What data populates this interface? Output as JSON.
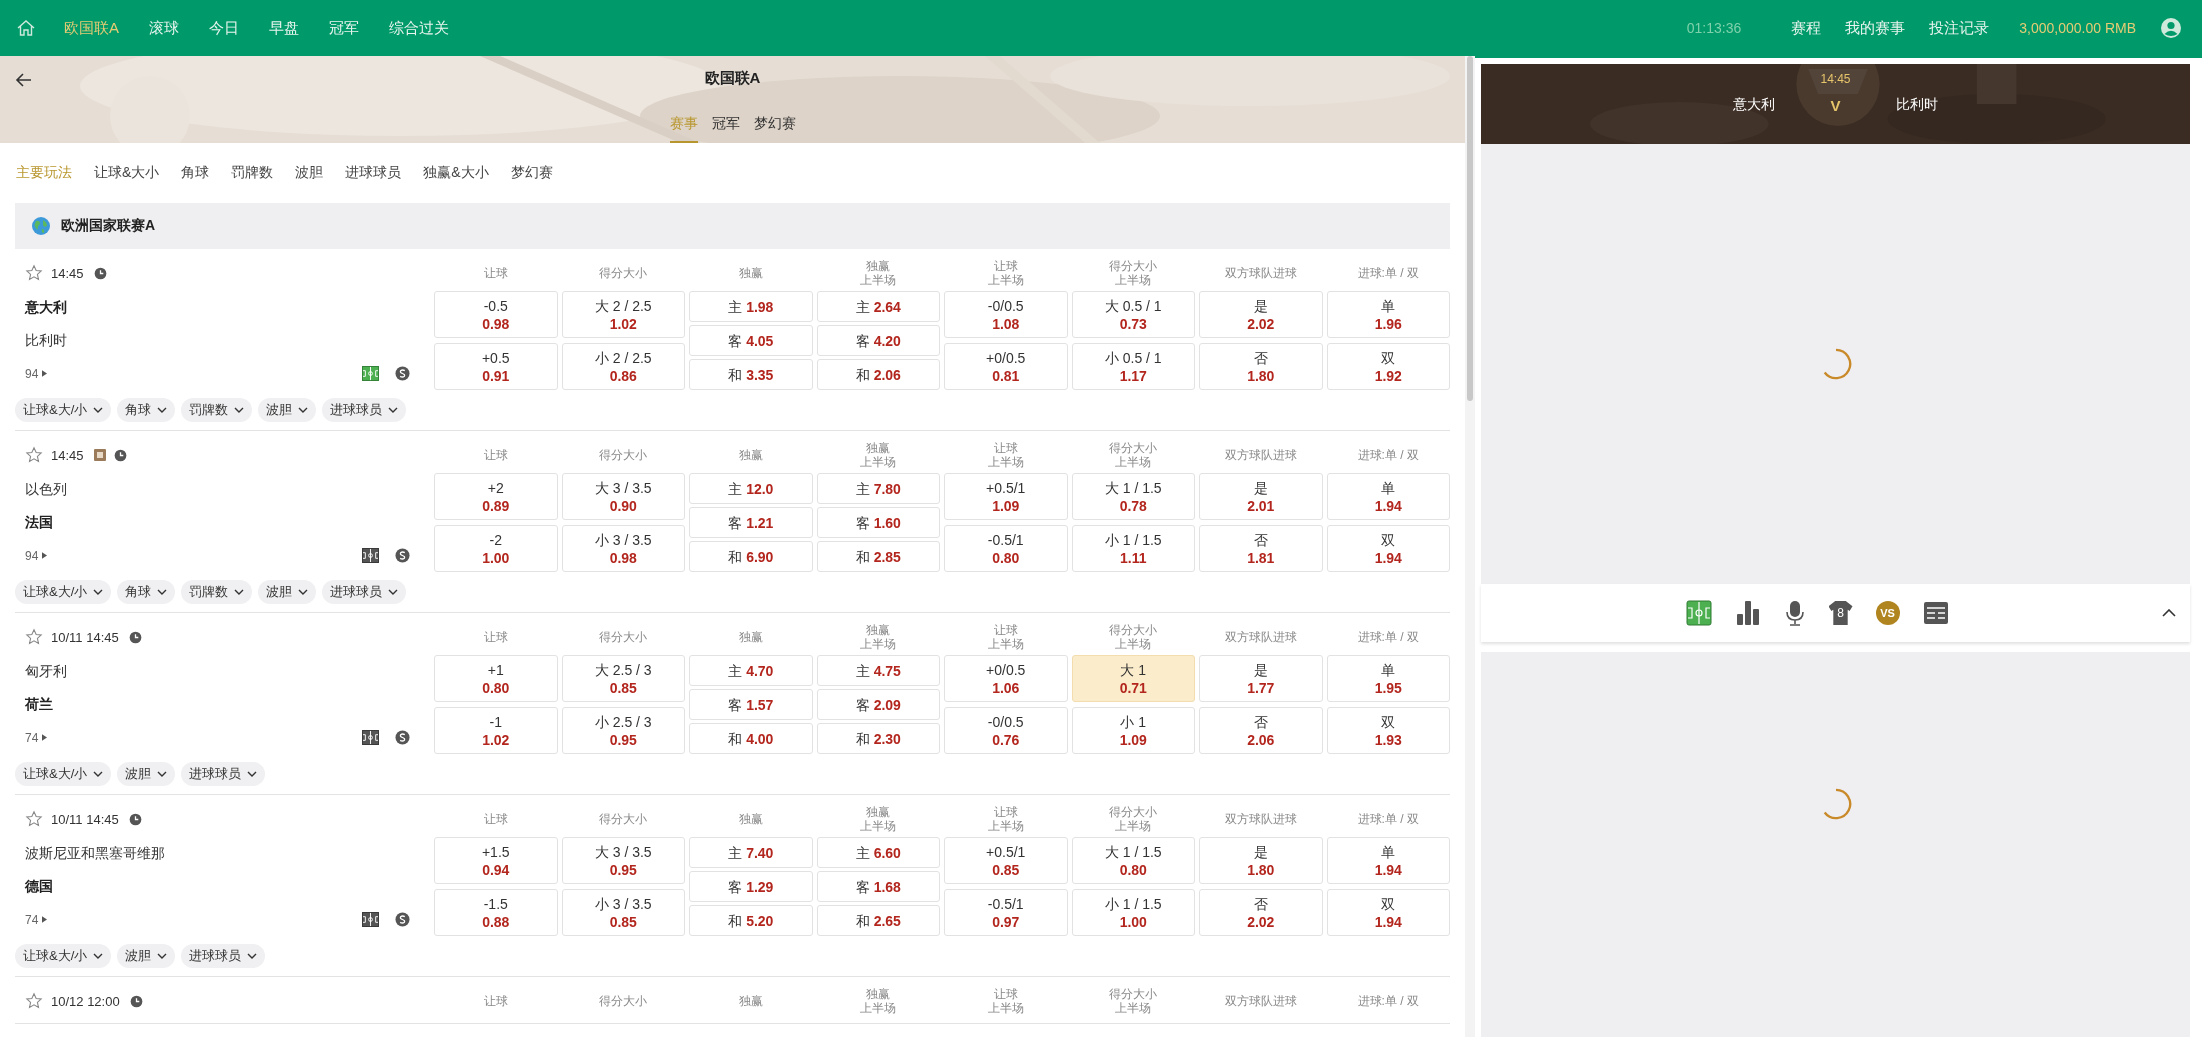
{
  "top_nav": {
    "items": [
      {
        "label": "欧国联A",
        "selected": true
      },
      {
        "label": "滚球",
        "selected": false
      },
      {
        "label": "今日",
        "selected": false
      },
      {
        "label": "早盘",
        "selected": false
      },
      {
        "label": "冠军",
        "selected": false
      },
      {
        "label": "综合过关",
        "selected": false
      }
    ],
    "clock": "01:13:36",
    "links": [
      "赛程",
      "我的赛事",
      "投注记录"
    ],
    "balance": "3,000,000.00 RMB"
  },
  "header": {
    "title": "欧国联A",
    "tabs": [
      {
        "label": "赛事",
        "selected": true
      },
      {
        "label": "冠军",
        "selected": false
      },
      {
        "label": "梦幻赛",
        "selected": false
      }
    ]
  },
  "market_tabs": [
    {
      "label": "主要玩法",
      "selected": true
    },
    {
      "label": "让球&大小",
      "selected": false
    },
    {
      "label": "角球",
      "selected": false
    },
    {
      "label": "罚牌数",
      "selected": false
    },
    {
      "label": "波胆",
      "selected": false
    },
    {
      "label": "进球球员",
      "selected": false
    },
    {
      "label": "独赢&大小",
      "selected": false
    },
    {
      "label": "梦幻赛",
      "selected": false
    }
  ],
  "league": {
    "name": "欧洲国家联赛A"
  },
  "matches": [
    {
      "time": "14:45",
      "favorite": false,
      "tracker_selected": true,
      "teams": [
        {
          "name": "意大利",
          "bold": true
        },
        {
          "name": "比利时",
          "bold": false
        }
      ],
      "count": "94",
      "chips": [
        "让球&大/小",
        "角球",
        "罚牌数",
        "波胆",
        "进球球员"
      ],
      "markets": [
        {
          "kind": "line",
          "header": "让球",
          "cells": [
            {
              "label": "-0.5",
              "price": "0.98",
              "selected": false
            },
            {
              "label": "+0.5",
              "price": "0.91",
              "selected": false
            }
          ]
        },
        {
          "kind": "line",
          "header": "得分大小",
          "cells": [
            {
              "label": "大 2 / 2.5",
              "price": "1.02",
              "selected": false
            },
            {
              "label": "小 2 / 2.5",
              "price": "0.86",
              "selected": false
            }
          ]
        },
        {
          "kind": "triple",
          "header": "独赢",
          "cells": [
            {
              "label": "主",
              "price": "1.98",
              "selected": false
            },
            {
              "label": "客",
              "price": "4.05",
              "selected": false
            },
            {
              "label": "和",
              "price": "3.35",
              "selected": false
            }
          ]
        },
        {
          "kind": "triple",
          "header": "独赢",
          "subheader": "上半场",
          "cells": [
            {
              "label": "主",
              "price": "2.64",
              "selected": false
            },
            {
              "label": "客",
              "price": "4.20",
              "selected": false
            },
            {
              "label": "和",
              "price": "2.06",
              "selected": false
            }
          ]
        },
        {
          "kind": "line",
          "header": "让球",
          "subheader": "上半场",
          "cells": [
            {
              "label": "-0/0.5",
              "price": "1.08",
              "selected": false
            },
            {
              "label": "+0/0.5",
              "price": "0.81",
              "selected": false
            }
          ]
        },
        {
          "kind": "line",
          "header": "得分大小",
          "subheader": "上半场",
          "cells": [
            {
              "label": "大 0.5 / 1",
              "price": "0.73",
              "selected": false
            },
            {
              "label": "小 0.5 / 1",
              "price": "1.17",
              "selected": false
            }
          ]
        },
        {
          "kind": "line",
          "header": "双方球队进球",
          "cells": [
            {
              "label": "是",
              "price": "2.02",
              "selected": false
            },
            {
              "label": "否",
              "price": "1.80",
              "selected": false
            }
          ]
        },
        {
          "kind": "line",
          "header": "进球:单 / 双",
          "cells": [
            {
              "label": "单",
              "price": "1.96",
              "selected": false
            },
            {
              "label": "双",
              "price": "1.92",
              "selected": false
            }
          ]
        }
      ]
    },
    {
      "time": "14:45",
      "favorite": false,
      "badge": true,
      "tracker_selected": false,
      "teams": [
        {
          "name": "以色列",
          "bold": false
        },
        {
          "name": "法国",
          "bold": true
        }
      ],
      "count": "94",
      "chips": [
        "让球&大/小",
        "角球",
        "罚牌数",
        "波胆",
        "进球球员"
      ],
      "markets": [
        {
          "kind": "line",
          "header": "让球",
          "cells": [
            {
              "label": "+2",
              "price": "0.89",
              "selected": false
            },
            {
              "label": "-2",
              "price": "1.00",
              "selected": false
            }
          ]
        },
        {
          "kind": "line",
          "header": "得分大小",
          "cells": [
            {
              "label": "大 3 / 3.5",
              "price": "0.90",
              "selected": false
            },
            {
              "label": "小 3 / 3.5",
              "price": "0.98",
              "selected": false
            }
          ]
        },
        {
          "kind": "triple",
          "header": "独赢",
          "cells": [
            {
              "label": "主",
              "price": "12.0",
              "selected": false
            },
            {
              "label": "客",
              "price": "1.21",
              "selected": false
            },
            {
              "label": "和",
              "price": "6.90",
              "selected": false
            }
          ]
        },
        {
          "kind": "triple",
          "header": "独赢",
          "subheader": "上半场",
          "cells": [
            {
              "label": "主",
              "price": "7.80",
              "selected": false
            },
            {
              "label": "客",
              "price": "1.60",
              "selected": false
            },
            {
              "label": "和",
              "price": "2.85",
              "selected": false
            }
          ]
        },
        {
          "kind": "line",
          "header": "让球",
          "subheader": "上半场",
          "cells": [
            {
              "label": "+0.5/1",
              "price": "1.09",
              "selected": false
            },
            {
              "label": "-0.5/1",
              "price": "0.80",
              "selected": false
            }
          ]
        },
        {
          "kind": "line",
          "header": "得分大小",
          "subheader": "上半场",
          "cells": [
            {
              "label": "大 1 / 1.5",
              "price": "0.78",
              "selected": false
            },
            {
              "label": "小 1 / 1.5",
              "price": "1.11",
              "selected": false
            }
          ]
        },
        {
          "kind": "line",
          "header": "双方球队进球",
          "cells": [
            {
              "label": "是",
              "price": "2.01",
              "selected": false
            },
            {
              "label": "否",
              "price": "1.81",
              "selected": false
            }
          ]
        },
        {
          "kind": "line",
          "header": "进球:单 / 双",
          "cells": [
            {
              "label": "单",
              "price": "1.94",
              "selected": false
            },
            {
              "label": "双",
              "price": "1.94",
              "selected": false
            }
          ]
        }
      ]
    },
    {
      "time": "10/11 14:45",
      "favorite": false,
      "tracker_selected": false,
      "teams": [
        {
          "name": "匈牙利",
          "bold": false
        },
        {
          "name": "荷兰",
          "bold": true
        }
      ],
      "count": "74",
      "chips": [
        "让球&大/小",
        "波胆",
        "进球球员"
      ],
      "markets": [
        {
          "kind": "line",
          "header": "让球",
          "cells": [
            {
              "label": "+1",
              "price": "0.80",
              "selected": false
            },
            {
              "label": "-1",
              "price": "1.02",
              "selected": false
            }
          ]
        },
        {
          "kind": "line",
          "header": "得分大小",
          "cells": [
            {
              "label": "大 2.5 / 3",
              "price": "0.85",
              "selected": false
            },
            {
              "label": "小 2.5 / 3",
              "price": "0.95",
              "selected": false
            }
          ]
        },
        {
          "kind": "triple",
          "header": "独赢",
          "cells": [
            {
              "label": "主",
              "price": "4.70",
              "selected": false
            },
            {
              "label": "客",
              "price": "1.57",
              "selected": false
            },
            {
              "label": "和",
              "price": "4.00",
              "selected": false
            }
          ]
        },
        {
          "kind": "triple",
          "header": "独赢",
          "subheader": "上半场",
          "cells": [
            {
              "label": "主",
              "price": "4.75",
              "selected": false
            },
            {
              "label": "客",
              "price": "2.09",
              "selected": false
            },
            {
              "label": "和",
              "price": "2.30",
              "selected": false
            }
          ]
        },
        {
          "kind": "line",
          "header": "让球",
          "subheader": "上半场",
          "cells": [
            {
              "label": "+0/0.5",
              "price": "1.06",
              "selected": false
            },
            {
              "label": "-0/0.5",
              "price": "0.76",
              "selected": false
            }
          ]
        },
        {
          "kind": "line",
          "header": "得分大小",
          "subheader": "上半场",
          "cells": [
            {
              "label": "大 1",
              "price": "0.71",
              "selected": true
            },
            {
              "label": "小 1",
              "price": "1.09",
              "selected": false
            }
          ]
        },
        {
          "kind": "line",
          "header": "双方球队进球",
          "cells": [
            {
              "label": "是",
              "price": "1.77",
              "selected": false
            },
            {
              "label": "否",
              "price": "2.06",
              "selected": false
            }
          ]
        },
        {
          "kind": "line",
          "header": "进球:单 / 双",
          "cells": [
            {
              "label": "单",
              "price": "1.95",
              "selected": false
            },
            {
              "label": "双",
              "price": "1.93",
              "selected": false
            }
          ]
        }
      ]
    },
    {
      "time": "10/11 14:45",
      "favorite": false,
      "tracker_selected": false,
      "teams": [
        {
          "name": "波斯尼亚和黑塞哥维那",
          "bold": false
        },
        {
          "name": "德国",
          "bold": true
        }
      ],
      "count": "74",
      "chips": [
        "让球&大/小",
        "波胆",
        "进球球员"
      ],
      "markets": [
        {
          "kind": "line",
          "header": "让球",
          "cells": [
            {
              "label": "+1.5",
              "price": "0.94",
              "selected": false
            },
            {
              "label": "-1.5",
              "price": "0.88",
              "selected": false
            }
          ]
        },
        {
          "kind": "line",
          "header": "得分大小",
          "cells": [
            {
              "label": "大 3 / 3.5",
              "price": "0.95",
              "selected": false
            },
            {
              "label": "小 3 / 3.5",
              "price": "0.85",
              "selected": false
            }
          ]
        },
        {
          "kind": "triple",
          "header": "独赢",
          "cells": [
            {
              "label": "主",
              "price": "7.40",
              "selected": false
            },
            {
              "label": "客",
              "price": "1.29",
              "selected": false
            },
            {
              "label": "和",
              "price": "5.20",
              "selected": false
            }
          ]
        },
        {
          "kind": "triple",
          "header": "独赢",
          "subheader": "上半场",
          "cells": [
            {
              "label": "主",
              "price": "6.60",
              "selected": false
            },
            {
              "label": "客",
              "price": "1.68",
              "selected": false
            },
            {
              "label": "和",
              "price": "2.65",
              "selected": false
            }
          ]
        },
        {
          "kind": "line",
          "header": "让球",
          "subheader": "上半场",
          "cells": [
            {
              "label": "+0.5/1",
              "price": "0.85",
              "selected": false
            },
            {
              "label": "-0.5/1",
              "price": "0.97",
              "selected": false
            }
          ]
        },
        {
          "kind": "line",
          "header": "得分大小",
          "subheader": "上半场",
          "cells": [
            {
              "label": "大 1 / 1.5",
              "price": "0.80",
              "selected": false
            },
            {
              "label": "小 1 / 1.5",
              "price": "1.00",
              "selected": false
            }
          ]
        },
        {
          "kind": "line",
          "header": "双方球队进球",
          "cells": [
            {
              "label": "是",
              "price": "1.80",
              "selected": false
            },
            {
              "label": "否",
              "price": "2.02",
              "selected": false
            }
          ]
        },
        {
          "kind": "line",
          "header": "进球:单 / 双",
          "cells": [
            {
              "label": "单",
              "price": "1.94",
              "selected": false
            },
            {
              "label": "双",
              "price": "1.94",
              "selected": false
            }
          ]
        }
      ]
    },
    {
      "time": "10/12 12:00",
      "favorite": false,
      "markets": [
        {
          "header": "让球"
        },
        {
          "header": "得分大小"
        },
        {
          "header": "独赢"
        },
        {
          "header": "独赢",
          "subheader": "上半场"
        },
        {
          "header": "让球",
          "subheader": "上半场"
        },
        {
          "header": "得分大小",
          "subheader": "上半场"
        },
        {
          "header": "双方球队进球"
        },
        {
          "header": "进球:单 / 双"
        }
      ]
    }
  ],
  "scoreboard": {
    "time": "14:45",
    "home": "意大利",
    "versus": "V",
    "away": "比利时"
  },
  "tools": [
    {
      "kind": "pitch",
      "selected": true
    },
    {
      "kind": "stats",
      "selected": false
    },
    {
      "kind": "mic",
      "selected": false
    },
    {
      "kind": "shirt",
      "label": "8",
      "selected": false
    },
    {
      "kind": "vs",
      "label": "VS",
      "selected": false
    },
    {
      "kind": "board",
      "selected": false
    }
  ]
}
